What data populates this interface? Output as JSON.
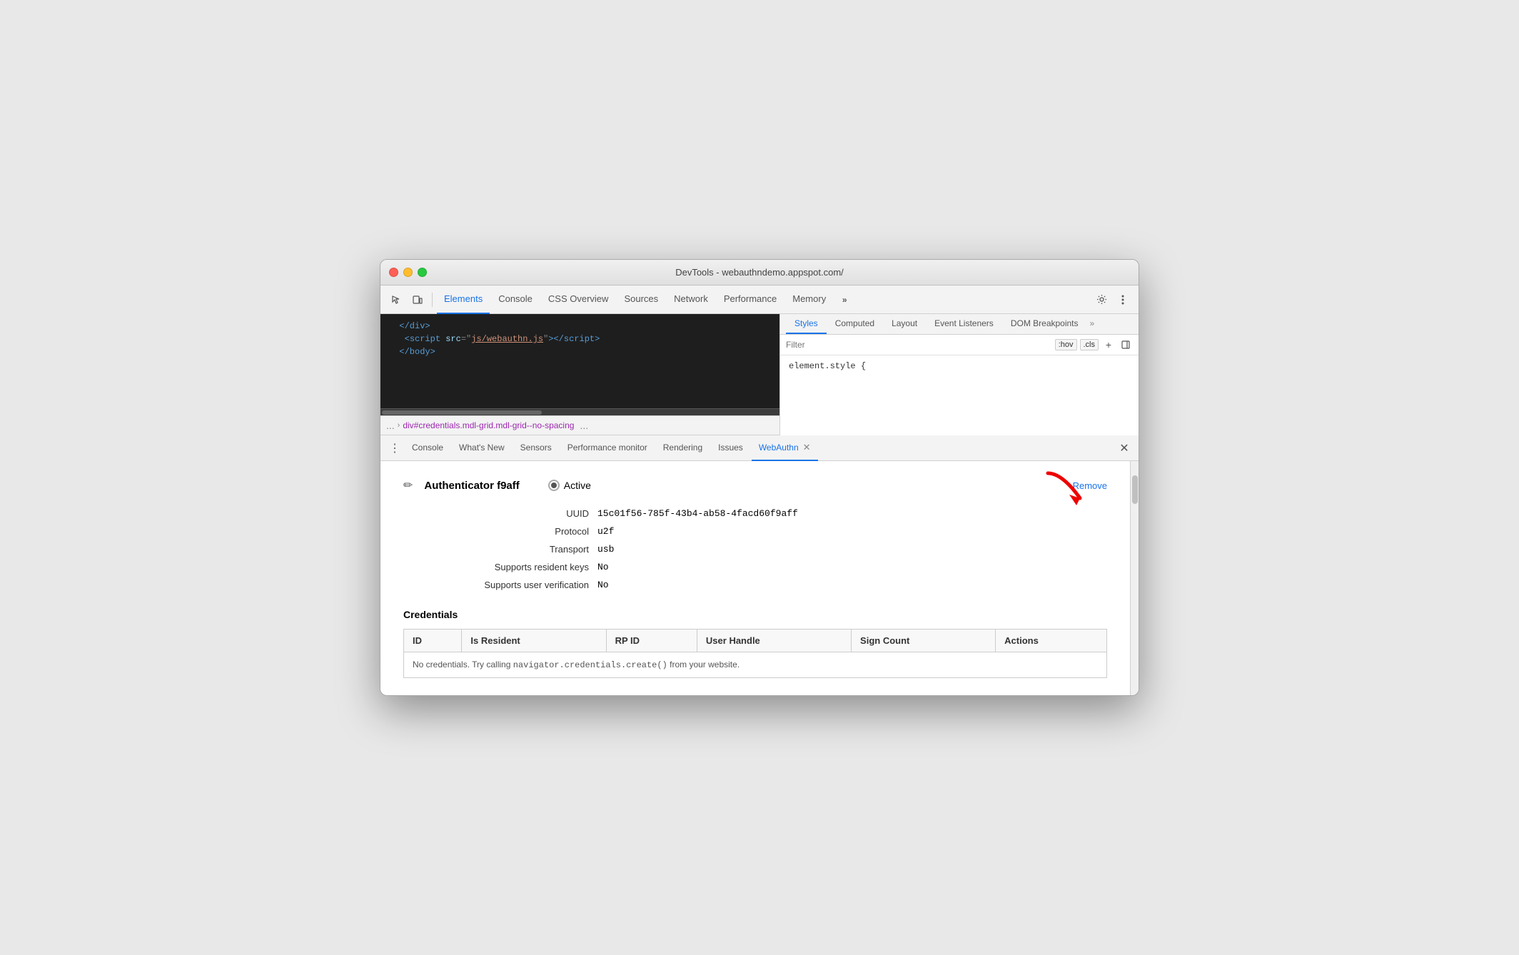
{
  "window": {
    "title": "DevTools - webauthndemo.appspot.com/"
  },
  "toolbar": {
    "tabs": [
      {
        "label": "Elements",
        "active": true
      },
      {
        "label": "Console",
        "active": false
      },
      {
        "label": "CSS Overview",
        "active": false
      },
      {
        "label": "Sources",
        "active": false
      },
      {
        "label": "Network",
        "active": false
      },
      {
        "label": "Performance",
        "active": false
      },
      {
        "label": "Memory",
        "active": false
      }
    ],
    "overflow_label": "»",
    "settings_title": "Settings",
    "more_title": "More"
  },
  "styles_panel": {
    "tabs": [
      "Styles",
      "Computed",
      "Layout",
      "Event Listeners",
      "DOM Breakpoints"
    ],
    "active_tab": "Styles",
    "overflow_label": "»",
    "filter_placeholder": "Filter",
    "hov_btn": ":hov",
    "cls_btn": ".cls",
    "element_style": "element.style {"
  },
  "breadcrumb": {
    "dots": "...",
    "path": "div#credentials.mdl-grid.mdl-grid--no-spacing",
    "more": "..."
  },
  "code_panel": {
    "line1": "</div>",
    "line2_open": "<script src=\"",
    "line2_link": "js/webauthn.js",
    "line2_close": "\"></",
    "line2_tag": "script>",
    "line3": "</body>"
  },
  "drawer": {
    "tabs": [
      {
        "label": "Console",
        "active": false,
        "closeable": false
      },
      {
        "label": "What's New",
        "active": false,
        "closeable": false
      },
      {
        "label": "Sensors",
        "active": false,
        "closeable": false
      },
      {
        "label": "Performance monitor",
        "active": false,
        "closeable": false
      },
      {
        "label": "Rendering",
        "active": false,
        "closeable": false
      },
      {
        "label": "Issues",
        "active": false,
        "closeable": false
      },
      {
        "label": "WebAuthn",
        "active": true,
        "closeable": true
      }
    ]
  },
  "webauthn": {
    "authenticator": {
      "name": "Authenticator f9aff",
      "status": "Active",
      "remove_label": "Remove",
      "uuid_label": "UUID",
      "uuid_value": "15c01f56-785f-43b4-ab58-4facd60f9aff",
      "protocol_label": "Protocol",
      "protocol_value": "u2f",
      "transport_label": "Transport",
      "transport_value": "usb",
      "resident_keys_label": "Supports resident keys",
      "resident_keys_value": "No",
      "user_verification_label": "Supports user verification",
      "user_verification_value": "No"
    },
    "credentials": {
      "section_title": "Credentials",
      "columns": [
        "ID",
        "Is Resident",
        "RP ID",
        "User Handle",
        "Sign Count",
        "Actions"
      ],
      "empty_message_prefix": "No credentials. Try calling ",
      "empty_code": "navigator.credentials.create()",
      "empty_message_suffix": " from your website."
    }
  }
}
